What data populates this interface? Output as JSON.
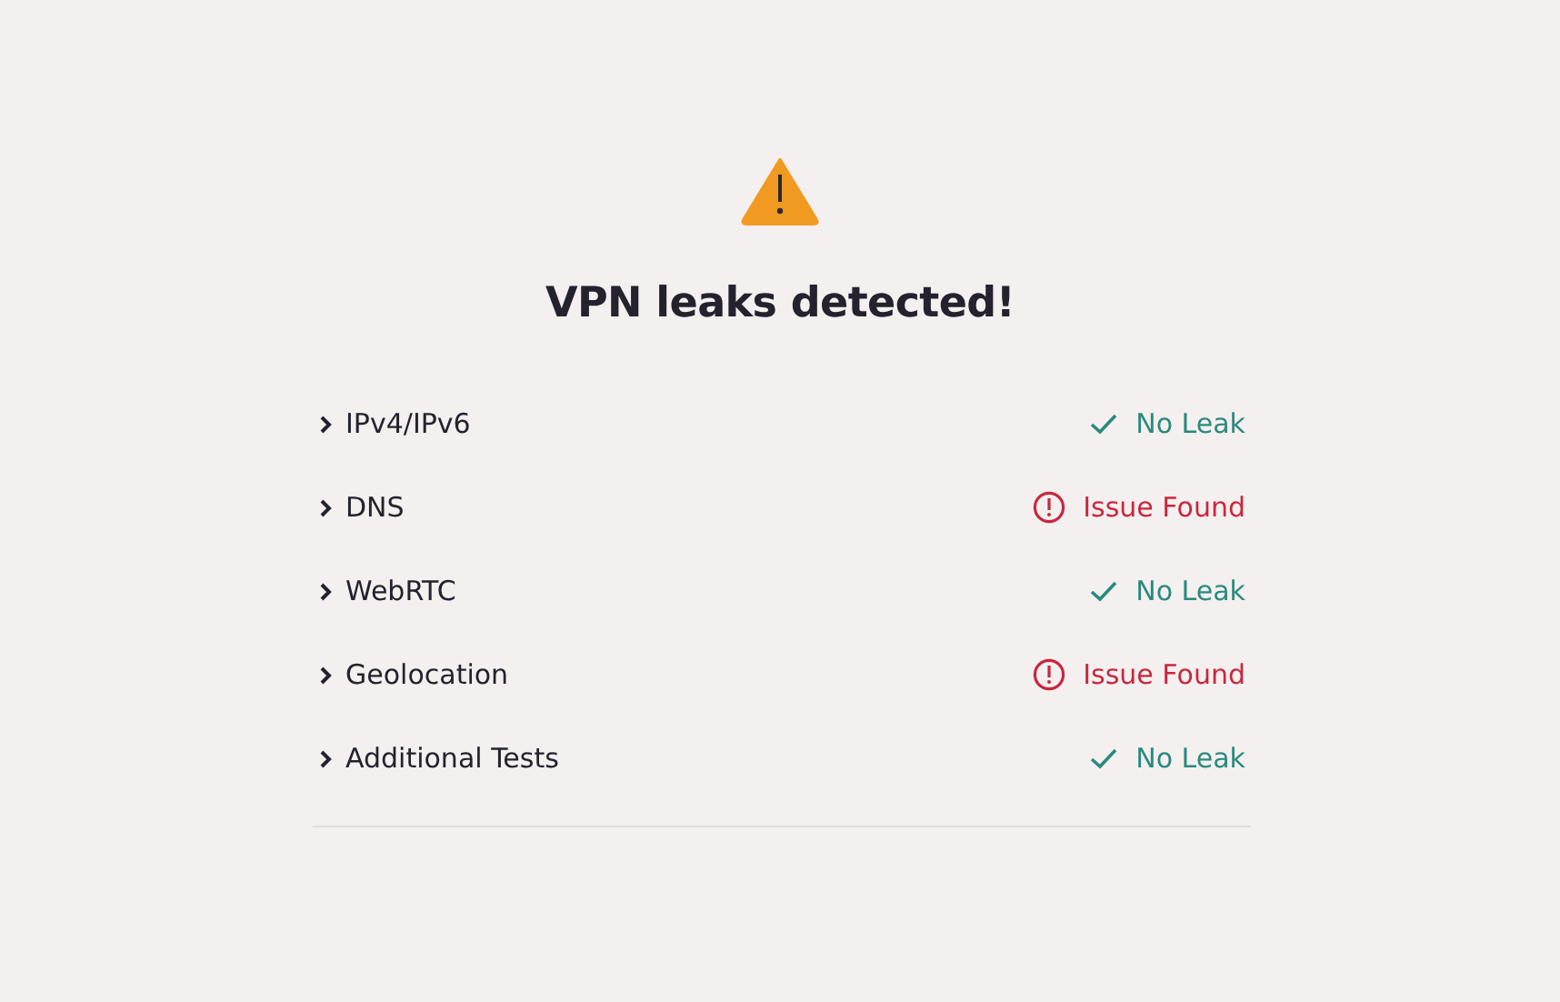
{
  "title": "VPN leaks detected!",
  "tests": [
    {
      "label": "IPv4/IPv6",
      "expanded": false,
      "kind": "ok",
      "status": "No Leak"
    },
    {
      "label": "DNS",
      "expanded": false,
      "kind": "issue",
      "status": "Issue Found"
    },
    {
      "label": "WebRTC",
      "expanded": false,
      "kind": "ok",
      "status": "No Leak"
    },
    {
      "label": "Geolocation",
      "expanded": false,
      "kind": "issue",
      "status": "Issue Found"
    },
    {
      "label": "Additional Tests",
      "expanded": false,
      "kind": "ok",
      "status": "No Leak"
    }
  ]
}
